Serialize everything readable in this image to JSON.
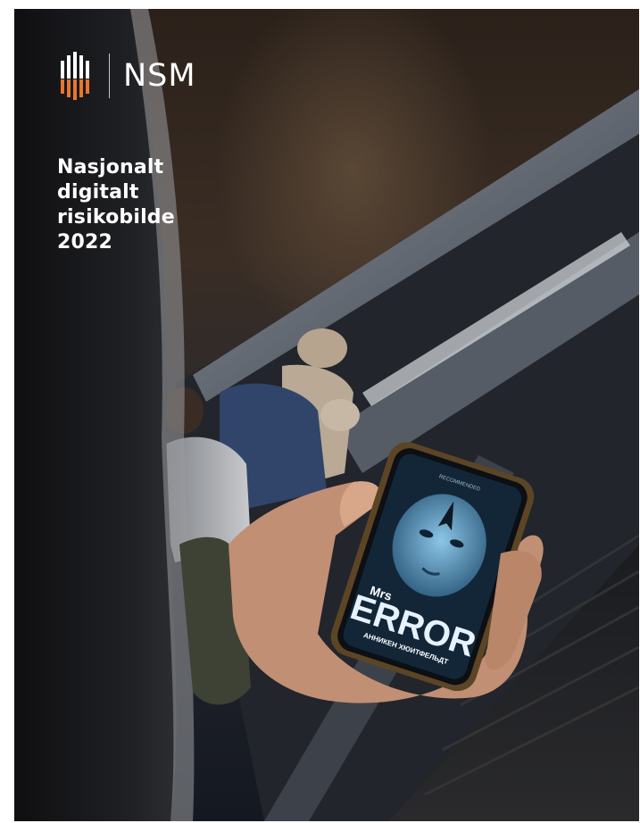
{
  "brand": {
    "name": "NSM"
  },
  "report": {
    "title_lines": [
      "Nasjonalt",
      "digitalt",
      "risikobilde",
      "2022"
    ]
  },
  "phone_screen": {
    "top_label": "RECOMMENDED",
    "title_small": "Mrs",
    "title_big": "ERROR",
    "author": "АННИКЕН ХЮИТФЕЛЬДТ"
  },
  "colors": {
    "logo_orange": "#e8762b",
    "text": "#ffffff"
  }
}
